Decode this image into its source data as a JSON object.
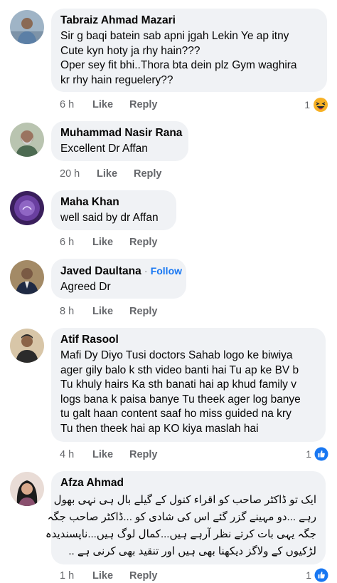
{
  "comments": [
    {
      "author": "Tabraiz Ahmad Mazari",
      "lines": [
        "Sir g baqi batein sab apni jgah Lekin Ye ap itny",
        "Cute kyn hoty ja rhy hain???",
        "Oper sey fit bhi..Thora bta dein plz Gym waghira",
        "kr rhy hain reguelery??"
      ],
      "time": "6 h",
      "like": "Like",
      "reply": "Reply",
      "reaction_count": "1",
      "reaction_icon": "haha-icon"
    },
    {
      "author": "Muhammad Nasir Rana",
      "lines": [
        "Excellent Dr Affan"
      ],
      "time": "20 h",
      "like": "Like",
      "reply": "Reply"
    },
    {
      "author": "Maha Khan",
      "lines": [
        "well said by dr Affan"
      ],
      "time": "6 h",
      "like": "Like",
      "reply": "Reply"
    },
    {
      "author": "Javed Daultana",
      "separator": "·",
      "follow": "Follow",
      "lines": [
        "Agreed Dr"
      ],
      "time": "8 h",
      "like": "Like",
      "reply": "Reply"
    },
    {
      "author": "Atif Rasool",
      "lines": [
        "Mafi Dy Diyo Tusi doctors Sahab logo ke biwiya",
        "ager gily balo k sth video banti hai Tu ap ke  BV b",
        "Tu khuly hairs Ka sth banati hai ap khud family v",
        "logs bana k paisa banye Tu theek ager log banye",
        "tu galt haan content saaf ho miss guided na kry",
        "Tu then theek hai ap KO kiya maslah hai"
      ],
      "time": "4 h",
      "like": "Like",
      "reply": "Reply",
      "reaction_count": "1",
      "reaction_icon": "like-icon"
    },
    {
      "author": "Afza Ahmad",
      "rtl_lines": [
        "ایک تو ڈاکٹر صاحب کو اقراء کنول کے گیلے بال ہی نہی بھول",
        "رہے ...دو مہینے گزر گئے اس کی شادی کو ...ڈاکٹر صاحب جگہ",
        "جگہ یہی بات کرتے نظر آرہے ہیں...کمال لوگ ہیں...ناپسندیدہ",
        "لڑکیوں کے ولاگز دیکھنا بھی ہیں اور تنقید بھی کرنی ہے .."
      ],
      "time": "1 h",
      "like": "Like",
      "reply": "Reply",
      "reaction_count": "1",
      "reaction_icon": "like-icon"
    }
  ],
  "colors": {
    "bubble": "#f0f2f5",
    "link": "#1877f2",
    "meta": "#65676b",
    "text": "#050505"
  }
}
